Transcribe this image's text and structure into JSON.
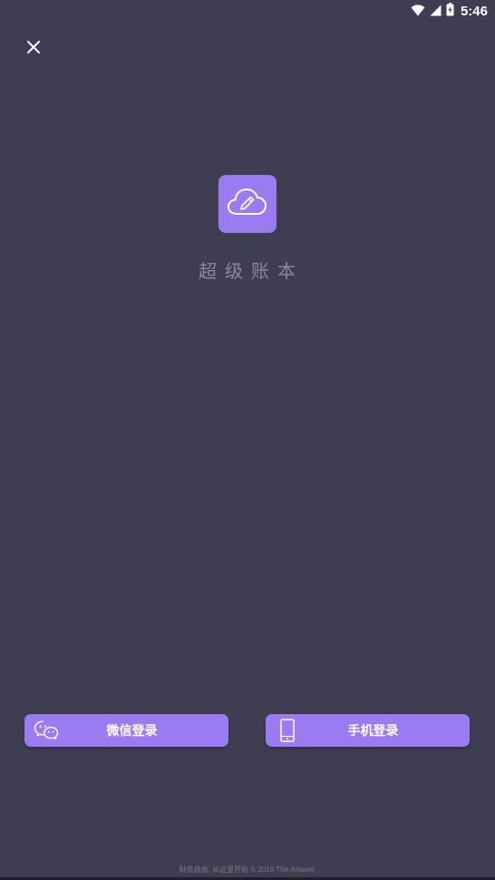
{
  "status_bar": {
    "time": "5:46",
    "icons": [
      "wifi-icon",
      "cell-signal-icon",
      "battery-charging-icon"
    ]
  },
  "header": {
    "close_icon": "close-icon"
  },
  "logo": {
    "icon": "cloud-pencil-icon",
    "background_color": "#9b7bf2"
  },
  "app_name": "超级账本",
  "login": {
    "wechat": {
      "label": "微信登录",
      "icon": "wechat-icon"
    },
    "phone": {
      "label": "手机登录",
      "icon": "smartphone-icon"
    }
  },
  "footer": {
    "text": "财务自由, 从这里开始 © 2019 The Answer."
  },
  "colors": {
    "background": "#3e3e52",
    "accent": "#9b7bf2"
  }
}
